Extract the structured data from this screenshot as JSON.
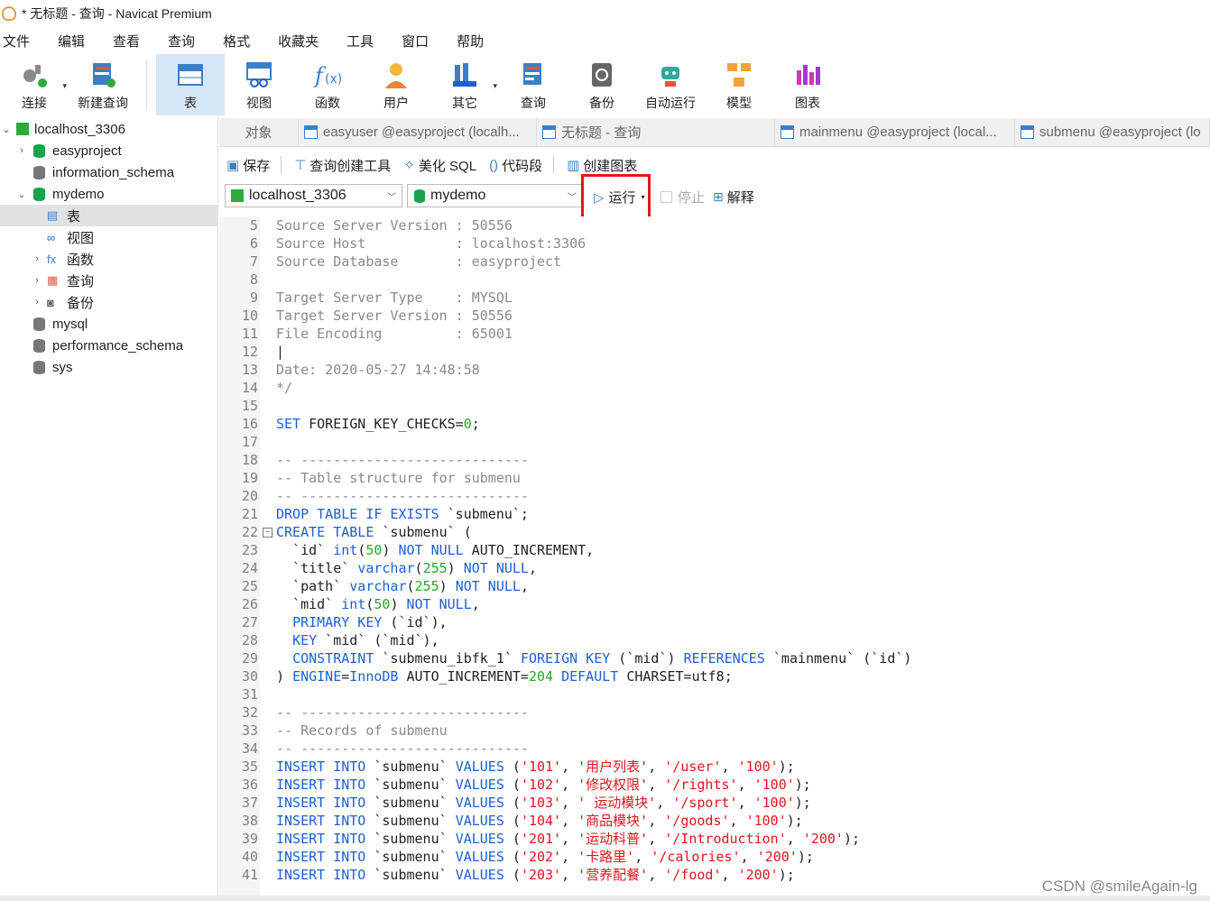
{
  "window": {
    "title": "* 无标题 - 查询 - Navicat Premium"
  },
  "menu": [
    "文件",
    "编辑",
    "查看",
    "查询",
    "格式",
    "收藏夹",
    "工具",
    "窗口",
    "帮助"
  ],
  "toolbar": [
    {
      "label": "连接",
      "icon": "connect-icon",
      "dropdown": true
    },
    {
      "label": "新建查询",
      "icon": "new-query-icon"
    },
    {
      "label": "表",
      "icon": "table-icon",
      "active": true
    },
    {
      "label": "视图",
      "icon": "view-icon"
    },
    {
      "label": "函数",
      "icon": "function-icon"
    },
    {
      "label": "用户",
      "icon": "user-icon"
    },
    {
      "label": "其它",
      "icon": "other-icon",
      "dropdown": true
    },
    {
      "label": "查询",
      "icon": "query-icon"
    },
    {
      "label": "备份",
      "icon": "backup-icon"
    },
    {
      "label": "自动运行",
      "icon": "robot-icon"
    },
    {
      "label": "模型",
      "icon": "model-icon"
    },
    {
      "label": "图表",
      "icon": "chart-icon"
    }
  ],
  "tree": [
    {
      "label": "localhost_3306",
      "level": 0,
      "twisty": "⌄",
      "icon": "server"
    },
    {
      "label": "easyproject",
      "level": 1,
      "twisty": "›",
      "icon": "db-green"
    },
    {
      "label": "information_schema",
      "level": 1,
      "twisty": "",
      "icon": "db-gray"
    },
    {
      "label": "mydemo",
      "level": 1,
      "twisty": "⌄",
      "icon": "db-green"
    },
    {
      "label": "表",
      "level": 2,
      "twisty": "",
      "icon": "table",
      "selected": true
    },
    {
      "label": "视图",
      "level": 2,
      "twisty": "",
      "icon": "view"
    },
    {
      "label": "函数",
      "level": 2,
      "twisty": "›",
      "icon": "func"
    },
    {
      "label": "查询",
      "level": 2,
      "twisty": "›",
      "icon": "query"
    },
    {
      "label": "备份",
      "level": 2,
      "twisty": "›",
      "icon": "backup"
    },
    {
      "label": "mysql",
      "level": 1,
      "twisty": "",
      "icon": "db-gray"
    },
    {
      "label": "performance_schema",
      "level": 1,
      "twisty": "",
      "icon": "db-gray"
    },
    {
      "label": "sys",
      "level": 1,
      "twisty": "",
      "icon": "db-gray"
    }
  ],
  "tabs": [
    {
      "label": "对象",
      "icon": false
    },
    {
      "label": "easyuser @easyproject (localh...",
      "icon": true
    },
    {
      "label": "无标题 - 查询",
      "icon": true,
      "active": true
    },
    {
      "label": "mainmenu @easyproject (local...",
      "icon": true
    },
    {
      "label": "submenu @easyproject (lo",
      "icon": true
    }
  ],
  "query_toolbar": {
    "save": "保存",
    "builder": "查询创建工具",
    "beautify": "美化 SQL",
    "snippet": "代码段",
    "chart": "创建图表",
    "connection": "localhost_3306",
    "database": "mydemo",
    "run": "运行",
    "stop": "停止",
    "explain": "解释"
  },
  "code_lines": [
    {
      "n": "5",
      "t": [
        [
          "cm",
          "Source Server Version : 50556"
        ]
      ]
    },
    {
      "n": "6",
      "t": [
        [
          "cm",
          "Source Host           : localhost:3306"
        ]
      ]
    },
    {
      "n": "7",
      "t": [
        [
          "cm",
          "Source Database       : easyproject"
        ]
      ]
    },
    {
      "n": "8",
      "t": []
    },
    {
      "n": "9",
      "t": [
        [
          "cm",
          "Target Server Type    : MYSQL"
        ]
      ]
    },
    {
      "n": "10",
      "t": [
        [
          "cm",
          "Target Server Version : 50556"
        ]
      ]
    },
    {
      "n": "11",
      "t": [
        [
          "cm",
          "File Encoding         : 65001"
        ]
      ]
    },
    {
      "n": "12",
      "t": [
        [
          "",
          "|"
        ]
      ]
    },
    {
      "n": "13",
      "t": [
        [
          "cm",
          "Date: 2020-05-27 14:48:58"
        ]
      ]
    },
    {
      "n": "14",
      "t": [
        [
          "cm",
          "*/"
        ]
      ]
    },
    {
      "n": "15",
      "t": []
    },
    {
      "n": "16",
      "t": [
        [
          "kw",
          "SET"
        ],
        [
          "",
          " FOREIGN_KEY_CHECKS="
        ],
        [
          "num",
          "0"
        ],
        [
          "",
          ";"
        ]
      ]
    },
    {
      "n": "17",
      "t": []
    },
    {
      "n": "18",
      "t": [
        [
          "cm",
          "-- ----------------------------"
        ]
      ]
    },
    {
      "n": "19",
      "t": [
        [
          "cm",
          "-- Table structure for submenu"
        ]
      ]
    },
    {
      "n": "20",
      "t": [
        [
          "cm",
          "-- ----------------------------"
        ]
      ]
    },
    {
      "n": "21",
      "t": [
        [
          "kw",
          "DROP TABLE IF EXISTS"
        ],
        [
          "",
          " `submenu`;"
        ]
      ]
    },
    {
      "n": "22",
      "t": [
        [
          "kw",
          "CREATE TABLE"
        ],
        [
          "",
          " `submenu` ("
        ]
      ],
      "fold": true
    },
    {
      "n": "23",
      "t": [
        [
          "",
          "  `id` "
        ],
        [
          "kw",
          "int"
        ],
        [
          "",
          "("
        ],
        [
          "num",
          "50"
        ],
        [
          "",
          ") "
        ],
        [
          "kw",
          "NOT NULL"
        ],
        [
          "",
          " AUTO_INCREMENT,"
        ]
      ]
    },
    {
      "n": "24",
      "t": [
        [
          "",
          "  `title` "
        ],
        [
          "kw",
          "varchar"
        ],
        [
          "",
          "("
        ],
        [
          "num",
          "255"
        ],
        [
          "",
          ") "
        ],
        [
          "kw",
          "NOT NULL"
        ],
        [
          "",
          ","
        ]
      ]
    },
    {
      "n": "25",
      "t": [
        [
          "",
          "  `path` "
        ],
        [
          "kw",
          "varchar"
        ],
        [
          "",
          "("
        ],
        [
          "num",
          "255"
        ],
        [
          "",
          ") "
        ],
        [
          "kw",
          "NOT NULL"
        ],
        [
          "",
          ","
        ]
      ]
    },
    {
      "n": "26",
      "t": [
        [
          "",
          "  `mid` "
        ],
        [
          "kw",
          "int"
        ],
        [
          "",
          "("
        ],
        [
          "num",
          "50"
        ],
        [
          "",
          ") "
        ],
        [
          "kw",
          "NOT NULL"
        ],
        [
          "",
          ","
        ]
      ]
    },
    {
      "n": "27",
      "t": [
        [
          "",
          "  "
        ],
        [
          "kw",
          "PRIMARY KEY"
        ],
        [
          "",
          " (`id`),"
        ]
      ]
    },
    {
      "n": "28",
      "t": [
        [
          "",
          "  "
        ],
        [
          "kw",
          "KEY"
        ],
        [
          "",
          " `mid` (`mid`),"
        ]
      ]
    },
    {
      "n": "29",
      "t": [
        [
          "",
          "  "
        ],
        [
          "kw",
          "CONSTRAINT"
        ],
        [
          "",
          " `submenu_ibfk_1` "
        ],
        [
          "kw",
          "FOREIGN KEY"
        ],
        [
          "",
          " (`mid`) "
        ],
        [
          "kw",
          "REFERENCES"
        ],
        [
          "",
          " `mainmenu` (`id`)"
        ]
      ]
    },
    {
      "n": "30",
      "t": [
        [
          "",
          ") "
        ],
        [
          "kw",
          "ENGINE"
        ],
        [
          "",
          "="
        ],
        [
          "kw",
          "InnoDB"
        ],
        [
          "",
          " AUTO_INCREMENT="
        ],
        [
          "num",
          "204"
        ],
        [
          "",
          " "
        ],
        [
          "kw",
          "DEFAULT"
        ],
        [
          "",
          " CHARSET=utf8;"
        ]
      ]
    },
    {
      "n": "31",
      "t": []
    },
    {
      "n": "32",
      "t": [
        [
          "cm",
          "-- ----------------------------"
        ]
      ]
    },
    {
      "n": "33",
      "t": [
        [
          "cm",
          "-- Records of submenu"
        ]
      ]
    },
    {
      "n": "34",
      "t": [
        [
          "cm",
          "-- ----------------------------"
        ]
      ]
    },
    {
      "n": "35",
      "t": [
        [
          "kw",
          "INSERT INTO"
        ],
        [
          "",
          " `submenu` "
        ],
        [
          "kw",
          "VALUES"
        ],
        [
          "",
          " ("
        ],
        [
          "str",
          "'101'"
        ],
        [
          "",
          ", "
        ],
        [
          "str",
          "'用户列表'"
        ],
        [
          "",
          ", "
        ],
        [
          "str",
          "'/user'"
        ],
        [
          "",
          ", "
        ],
        [
          "str",
          "'100'"
        ],
        [
          "",
          ");"
        ]
      ]
    },
    {
      "n": "36",
      "t": [
        [
          "kw",
          "INSERT INTO"
        ],
        [
          "",
          " `submenu` "
        ],
        [
          "kw",
          "VALUES"
        ],
        [
          "",
          " ("
        ],
        [
          "str",
          "'102'"
        ],
        [
          "",
          ", "
        ],
        [
          "str",
          "'修改权限'"
        ],
        [
          "",
          ", "
        ],
        [
          "str",
          "'/rights'"
        ],
        [
          "",
          ", "
        ],
        [
          "str",
          "'100'"
        ],
        [
          "",
          ");"
        ]
      ]
    },
    {
      "n": "37",
      "t": [
        [
          "kw",
          "INSERT INTO"
        ],
        [
          "",
          " `submenu` "
        ],
        [
          "kw",
          "VALUES"
        ],
        [
          "",
          " ("
        ],
        [
          "str",
          "'103'"
        ],
        [
          "",
          ", "
        ],
        [
          "str",
          "' 运动模块'"
        ],
        [
          "",
          ", "
        ],
        [
          "str",
          "'/sport'"
        ],
        [
          "",
          ", "
        ],
        [
          "str",
          "'100'"
        ],
        [
          "",
          ");"
        ]
      ]
    },
    {
      "n": "38",
      "t": [
        [
          "kw",
          "INSERT INTO"
        ],
        [
          "",
          " `submenu` "
        ],
        [
          "kw",
          "VALUES"
        ],
        [
          "",
          " ("
        ],
        [
          "str",
          "'104'"
        ],
        [
          "",
          ", "
        ],
        [
          "str",
          "'商品模块'"
        ],
        [
          "",
          ", "
        ],
        [
          "str",
          "'/goods'"
        ],
        [
          "",
          ", "
        ],
        [
          "str",
          "'100'"
        ],
        [
          "",
          ");"
        ]
      ]
    },
    {
      "n": "39",
      "t": [
        [
          "kw",
          "INSERT INTO"
        ],
        [
          "",
          " `submenu` "
        ],
        [
          "kw",
          "VALUES"
        ],
        [
          "",
          " ("
        ],
        [
          "str",
          "'201'"
        ],
        [
          "",
          ", "
        ],
        [
          "str",
          "'运动科普'"
        ],
        [
          "",
          ", "
        ],
        [
          "str",
          "'/Introduction'"
        ],
        [
          "",
          ", "
        ],
        [
          "str",
          "'200'"
        ],
        [
          "",
          ");"
        ]
      ]
    },
    {
      "n": "40",
      "t": [
        [
          "kw",
          "INSERT INTO"
        ],
        [
          "",
          " `submenu` "
        ],
        [
          "kw",
          "VALUES"
        ],
        [
          "",
          " ("
        ],
        [
          "str",
          "'202'"
        ],
        [
          "",
          ", "
        ],
        [
          "str",
          "'卡路里'"
        ],
        [
          "",
          ", "
        ],
        [
          "str",
          "'/calories'"
        ],
        [
          "",
          ", "
        ],
        [
          "str",
          "'200'"
        ],
        [
          "",
          ");"
        ]
      ]
    },
    {
      "n": "41",
      "t": [
        [
          "kw",
          "INSERT INTO"
        ],
        [
          "",
          " `submenu` "
        ],
        [
          "kw",
          "VALUES"
        ],
        [
          "",
          " ("
        ],
        [
          "str",
          "'203'"
        ],
        [
          "",
          ", "
        ],
        [
          "str",
          "'营养配餐'"
        ],
        [
          "",
          ", "
        ],
        [
          "str",
          "'/food'"
        ],
        [
          "",
          ", "
        ],
        [
          "str",
          "'200'"
        ],
        [
          "",
          ");"
        ]
      ]
    }
  ],
  "watermark": "CSDN @smileAgain-lg",
  "colors": {
    "keyword": "#1f5fcf",
    "number": "#2aa52a",
    "string": "#e0161e",
    "comment": "#8a8a8a",
    "highlight": "#e3161b",
    "active_toolbar": "#d6e8f7"
  }
}
